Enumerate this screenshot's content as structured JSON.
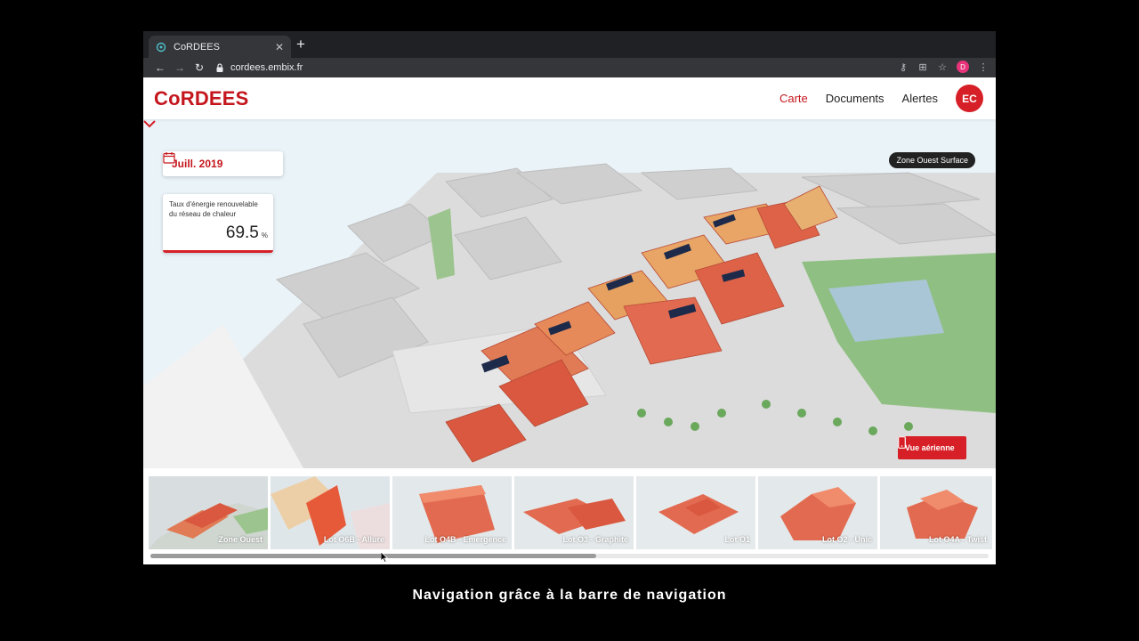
{
  "browser": {
    "tab_title": "CoRDEES",
    "url": "cordees.embix.fr",
    "profile_initial": "D"
  },
  "app": {
    "brand": "CoRDEES",
    "nav": {
      "map": "Carte",
      "documents": "Documents",
      "alerts": "Alertes"
    },
    "avatar": "EC"
  },
  "map": {
    "date": "Juill. 2019",
    "kpi": {
      "label": "Taux d'énergie renouvelable du réseau de chaleur",
      "value": "69.5",
      "unit": "%"
    },
    "zone": "Zone Ouest Surface",
    "aerial_button": "Vue aérienne"
  },
  "carousel": {
    "items": [
      {
        "label": "Zone Ouest"
      },
      {
        "label": "Lot O6B - Allure"
      },
      {
        "label": "Lot O4B - Emergence"
      },
      {
        "label": "Lot O3 - Graphite"
      },
      {
        "label": "Lot O1"
      },
      {
        "label": "Lot O2 - Unic"
      },
      {
        "label": "Lot O4A - Twist"
      }
    ]
  },
  "caption": "Navigation grâce à la barre de navigation",
  "colors": {
    "brand_red": "#c4161c",
    "accent_red": "#d61f26",
    "building": "#e26a50"
  }
}
